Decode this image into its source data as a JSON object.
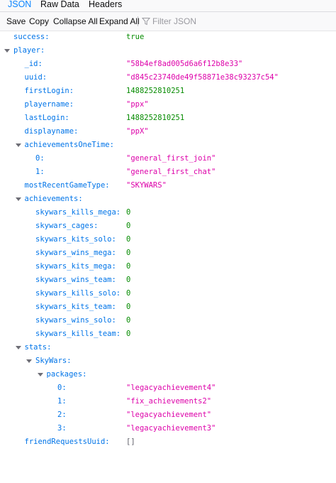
{
  "tabs": [
    "JSON",
    "Raw Data",
    "Headers"
  ],
  "toolbar": {
    "save": "Save",
    "copy": "Copy",
    "collapse_all": "Collapse All",
    "expand_all": "Expand All",
    "filter_placeholder": "Filter JSON"
  },
  "rows": [
    {
      "key": "success:",
      "value": "true",
      "type": "bool",
      "depth": 0,
      "expander": false
    },
    {
      "key": "player:",
      "value": "",
      "type": "obj",
      "depth": 0,
      "expander": true
    },
    {
      "key": "_id:",
      "value": "\"58b4ef8ad005d6a6f12b8e33\"",
      "type": "str",
      "depth": 1,
      "expander": false
    },
    {
      "key": "uuid:",
      "value": "\"d845c23740de49f58871e38c93237c54\"",
      "type": "str",
      "depth": 1,
      "expander": false
    },
    {
      "key": "firstLogin:",
      "value": "1488252810251",
      "type": "num",
      "depth": 1,
      "expander": false
    },
    {
      "key": "playername:",
      "value": "\"ppx\"",
      "type": "str",
      "depth": 1,
      "expander": false
    },
    {
      "key": "lastLogin:",
      "value": "1488252810251",
      "type": "num",
      "depth": 1,
      "expander": false
    },
    {
      "key": "displayname:",
      "value": "\"ppX\"",
      "type": "str",
      "depth": 1,
      "expander": false
    },
    {
      "key": "achievementsOneTime:",
      "value": "",
      "type": "obj",
      "depth": 1,
      "expander": true
    },
    {
      "key": "0:",
      "value": "\"general_first_join\"",
      "type": "str",
      "depth": 2,
      "expander": false
    },
    {
      "key": "1:",
      "value": "\"general_first_chat\"",
      "type": "str",
      "depth": 2,
      "expander": false
    },
    {
      "key": "mostRecentGameType:",
      "value": "\"SKYWARS\"",
      "type": "str",
      "depth": 1,
      "expander": false
    },
    {
      "key": "achievements:",
      "value": "",
      "type": "obj",
      "depth": 1,
      "expander": true
    },
    {
      "key": "skywars_kills_mega:",
      "value": "0",
      "type": "num",
      "depth": 2,
      "expander": false
    },
    {
      "key": "skywars_cages:",
      "value": "0",
      "type": "num",
      "depth": 2,
      "expander": false
    },
    {
      "key": "skywars_kits_solo:",
      "value": "0",
      "type": "num",
      "depth": 2,
      "expander": false
    },
    {
      "key": "skywars_wins_mega:",
      "value": "0",
      "type": "num",
      "depth": 2,
      "expander": false
    },
    {
      "key": "skywars_kits_mega:",
      "value": "0",
      "type": "num",
      "depth": 2,
      "expander": false
    },
    {
      "key": "skywars_wins_team:",
      "value": "0",
      "type": "num",
      "depth": 2,
      "expander": false
    },
    {
      "key": "skywars_kills_solo:",
      "value": "0",
      "type": "num",
      "depth": 2,
      "expander": false
    },
    {
      "key": "skywars_kits_team:",
      "value": "0",
      "type": "num",
      "depth": 2,
      "expander": false
    },
    {
      "key": "skywars_wins_solo:",
      "value": "0",
      "type": "num",
      "depth": 2,
      "expander": false
    },
    {
      "key": "skywars_kills_team:",
      "value": "0",
      "type": "num",
      "depth": 2,
      "expander": false
    },
    {
      "key": "stats:",
      "value": "",
      "type": "obj",
      "depth": 1,
      "expander": true
    },
    {
      "key": "SkyWars:",
      "value": "",
      "type": "obj",
      "depth": 2,
      "expander": true
    },
    {
      "key": "packages:",
      "value": "",
      "type": "obj",
      "depth": 3,
      "expander": true
    },
    {
      "key": "0:",
      "value": "\"legacyachievement4\"",
      "type": "str",
      "depth": 4,
      "expander": false
    },
    {
      "key": "1:",
      "value": "\"fix_achievements2\"",
      "type": "str",
      "depth": 4,
      "expander": false
    },
    {
      "key": "2:",
      "value": "\"legacyachievement\"",
      "type": "str",
      "depth": 4,
      "expander": false
    },
    {
      "key": "3:",
      "value": "\"legacyachievement3\"",
      "type": "str",
      "depth": 4,
      "expander": false
    },
    {
      "key": "friendRequestsUuid:",
      "value": "[]",
      "type": "arr",
      "depth": 1,
      "expander": false
    }
  ],
  "colors": {
    "key": "#0074e8",
    "string": "#dd00a9",
    "number": "#058b00",
    "selected_tab": "#0a84ff"
  },
  "icons": {
    "filter": "filter-funnel-icon",
    "expander": "triangle-down-icon"
  }
}
